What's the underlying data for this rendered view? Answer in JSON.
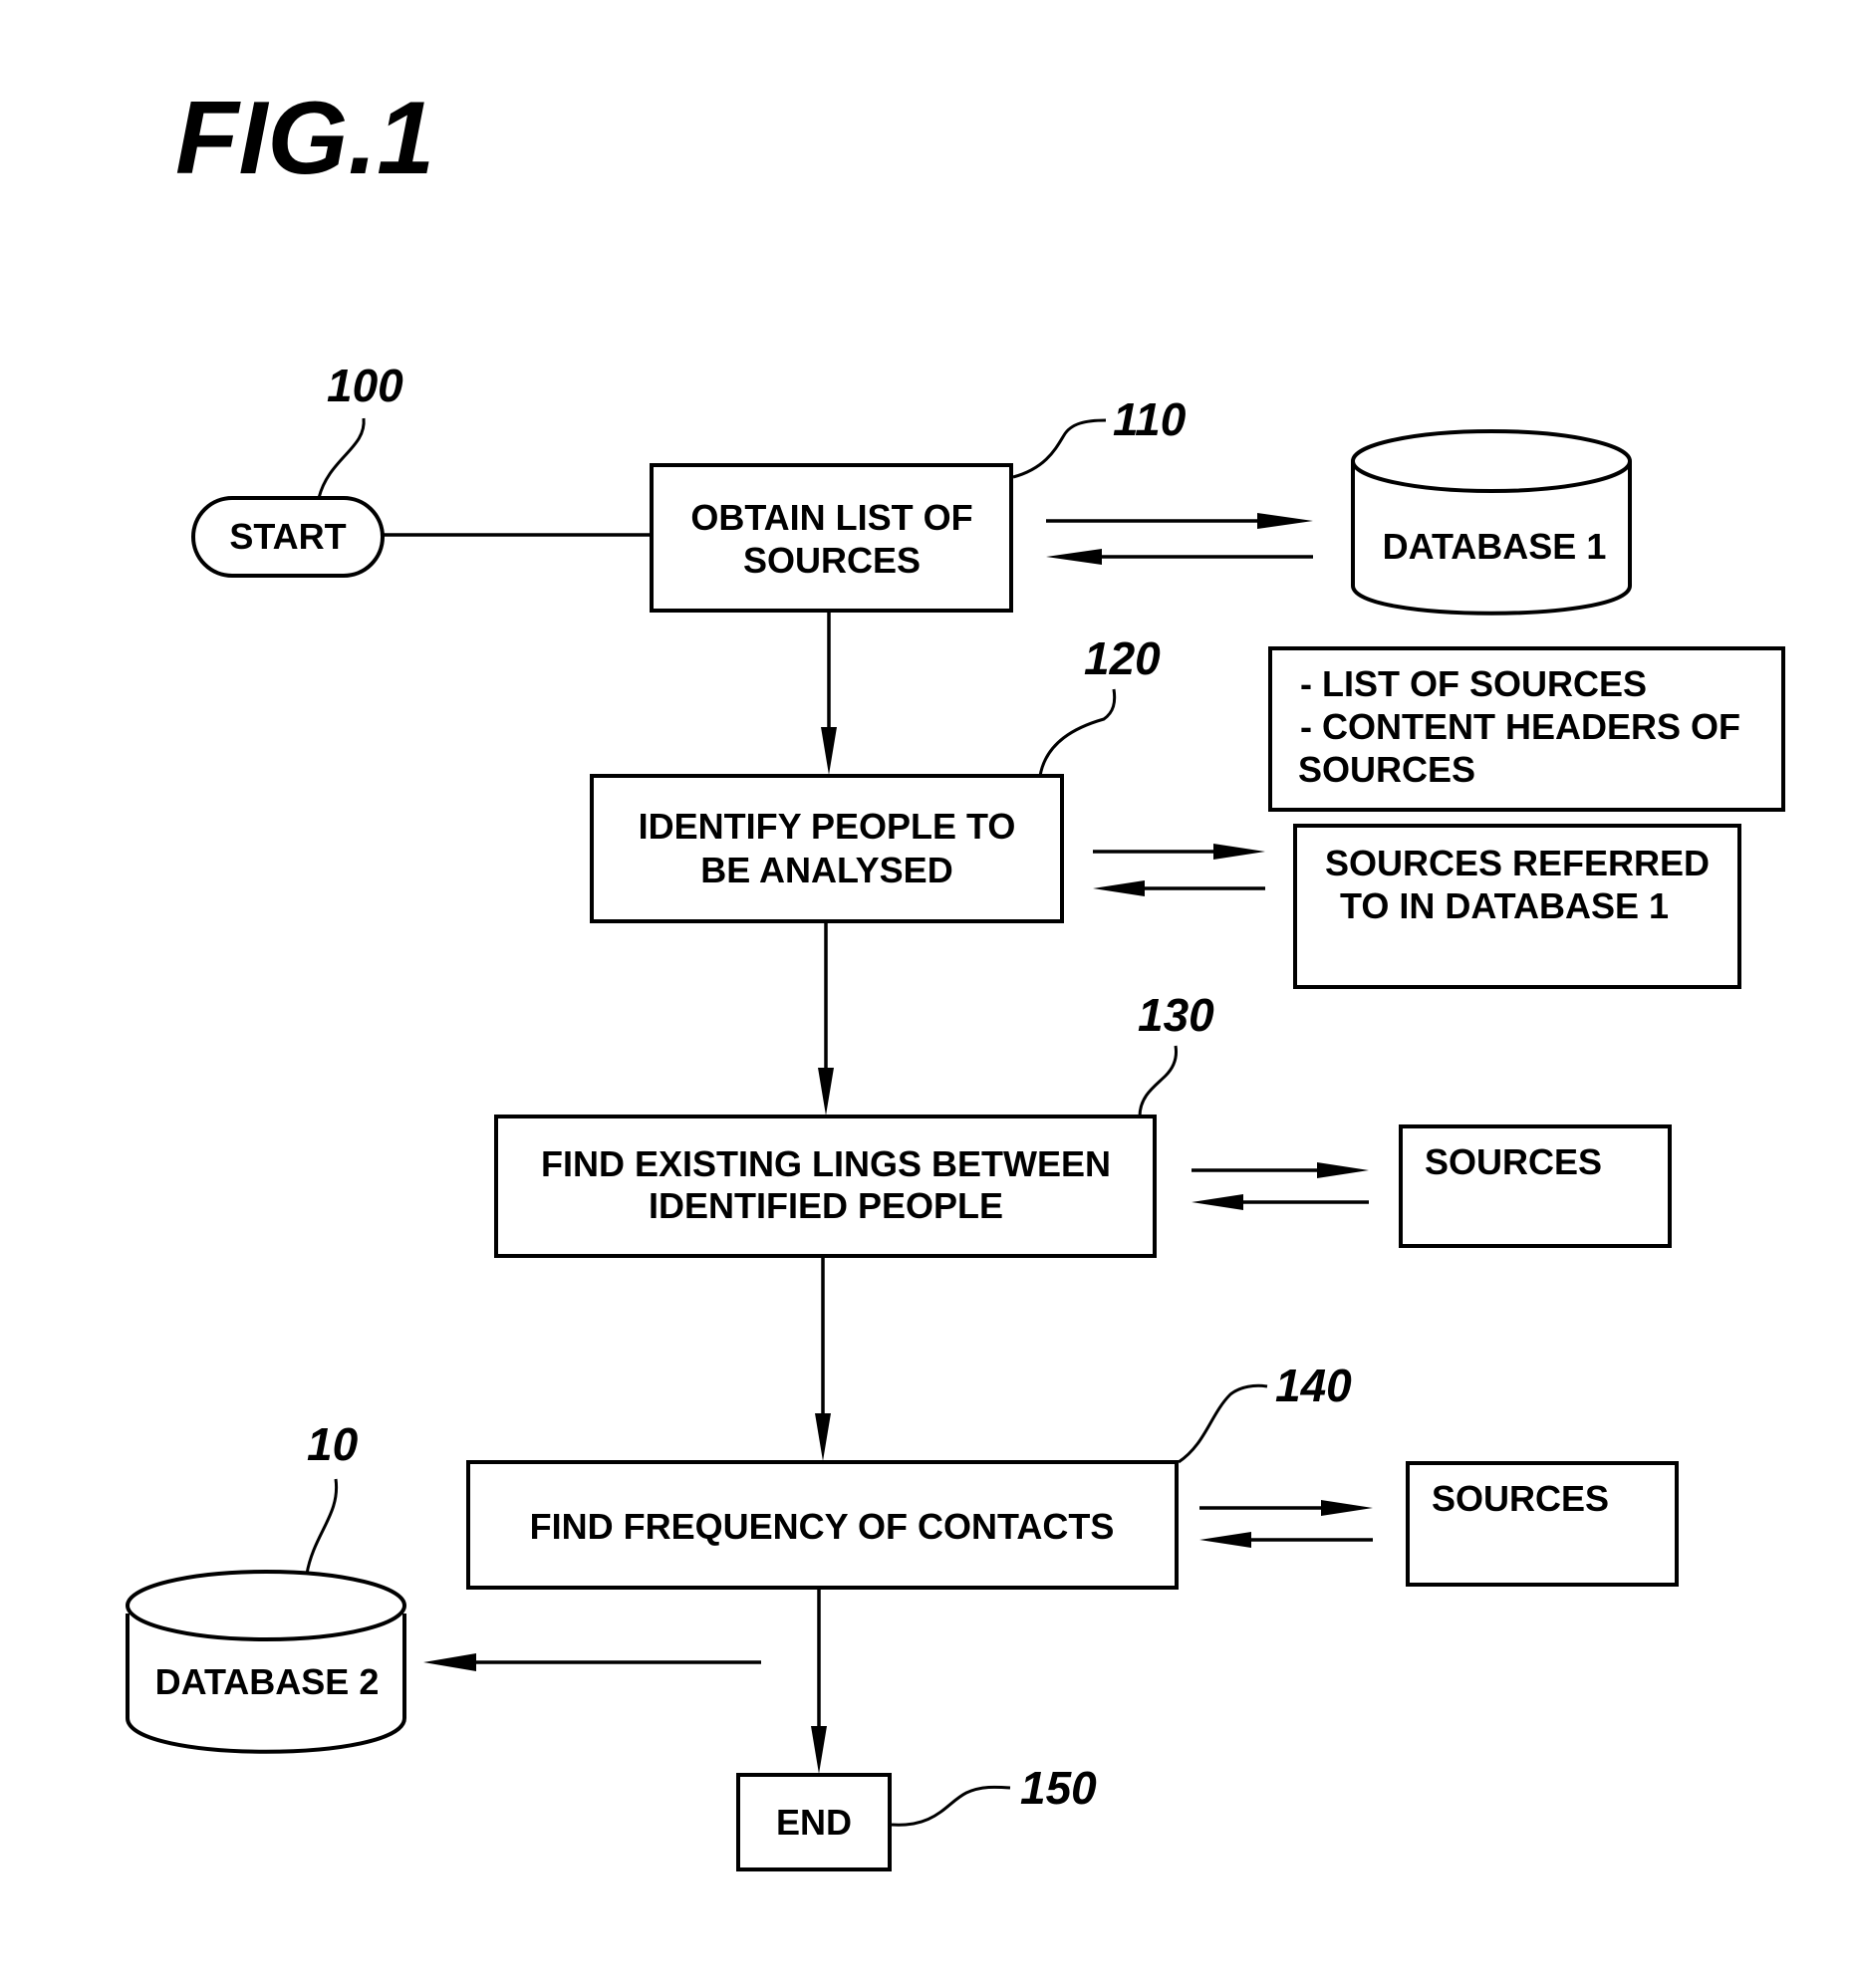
{
  "figure": {
    "title": "FIG.1"
  },
  "nodes": {
    "start": {
      "label": "START",
      "ref": "100"
    },
    "step110": {
      "lines": [
        "OBTAIN LIST OF",
        "SOURCES"
      ],
      "ref": "110"
    },
    "database1": {
      "label": "DATABASE 1"
    },
    "db1_contents": {
      "lines": [
        "- LIST OF SOURCES",
        "- CONTENT HEADERS OF",
        "SOURCES"
      ]
    },
    "step120": {
      "lines": [
        "IDENTIFY PEOPLE TO",
        "BE ANALYSED"
      ],
      "ref": "120"
    },
    "sources_referred": {
      "lines": [
        "SOURCES REFERRED",
        "TO IN DATABASE 1"
      ]
    },
    "step130": {
      "lines": [
        "FIND EXISTING LINGS BETWEEN",
        "IDENTIFIED PEOPLE"
      ],
      "ref": "130"
    },
    "sources130": {
      "label": "SOURCES"
    },
    "step140": {
      "label": "FIND FREQUENCY OF CONTACTS",
      "ref": "140"
    },
    "sources140": {
      "label": "SOURCES"
    },
    "database2": {
      "label": "DATABASE 2",
      "ref": "10"
    },
    "end": {
      "label": "END",
      "ref": "150"
    }
  }
}
